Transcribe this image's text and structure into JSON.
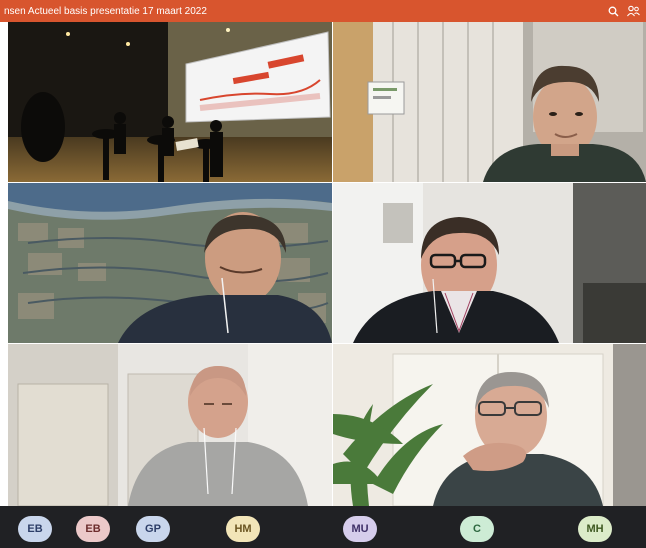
{
  "window": {
    "title": "nsen Actueel basis presentatie 17 maart 2022"
  },
  "icons": {
    "search": "search-icon",
    "participants": "participants-icon"
  },
  "colors": {
    "titlebar": "#d8552e",
    "bottombar": "#202124"
  },
  "participants": [
    {
      "initials": "EB"
    },
    {
      "initials": "EB"
    },
    {
      "initials": "GP"
    },
    {
      "initials": "HM"
    },
    {
      "initials": "MU"
    },
    {
      "initials": "C"
    },
    {
      "initials": "MH"
    }
  ]
}
